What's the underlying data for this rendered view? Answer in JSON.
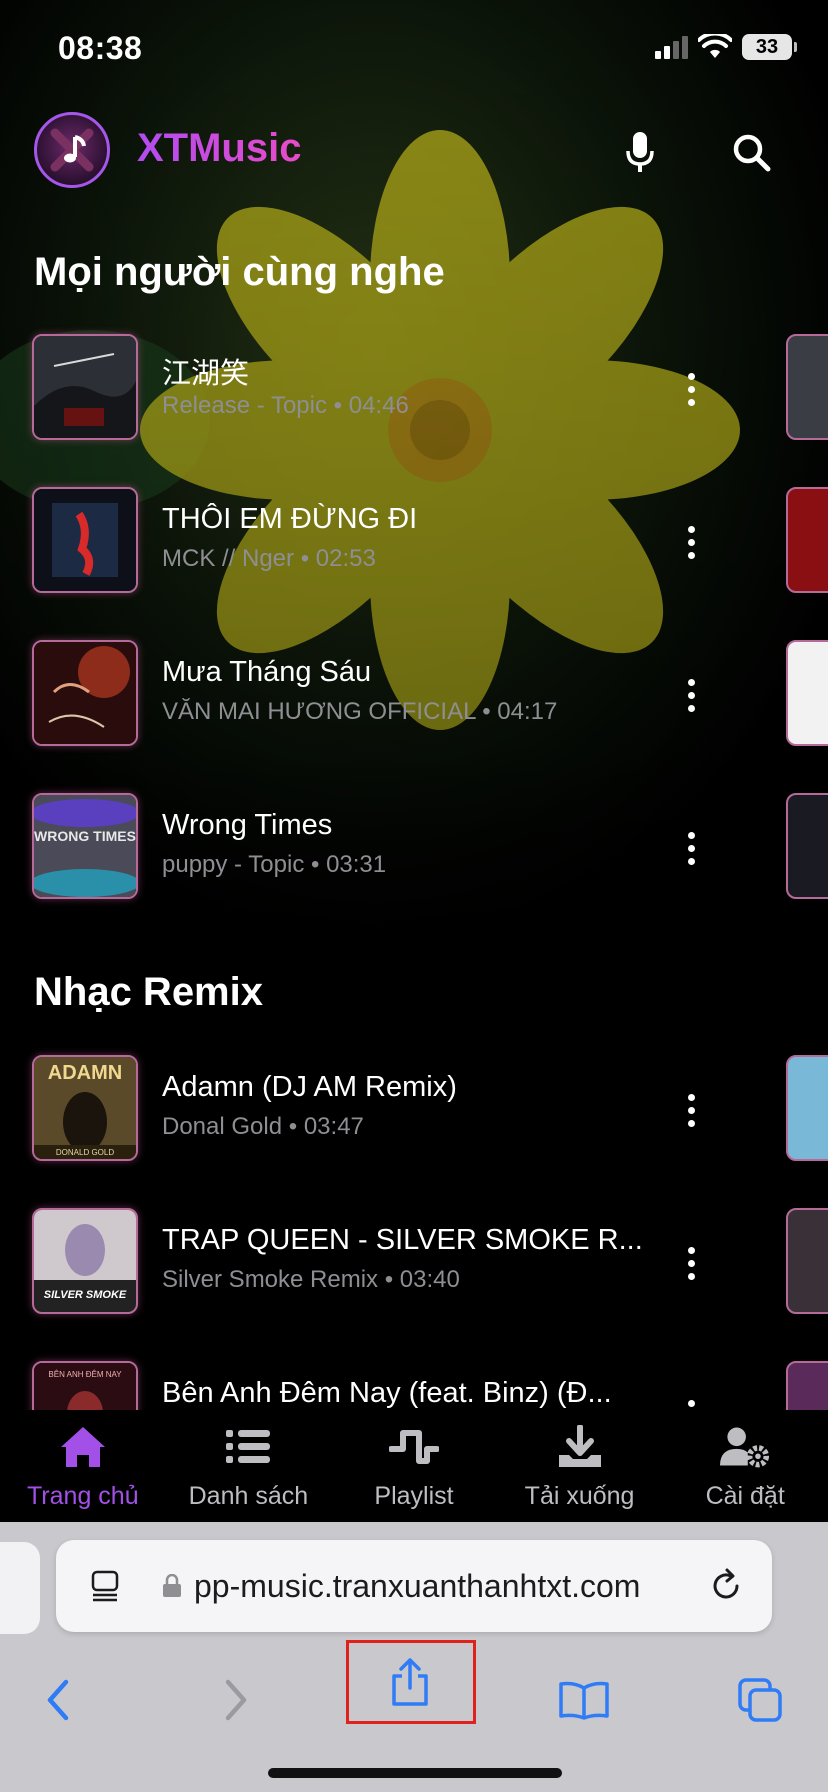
{
  "status_bar": {
    "time": "08:38",
    "battery": "33"
  },
  "header": {
    "app_title": "XTMusic"
  },
  "sections": [
    {
      "title": "Mọi người cùng nghe",
      "songs": [
        {
          "title": "江湖笑",
          "artist": "Release - Topic",
          "duration": "04:46"
        },
        {
          "title": "THÔI EM ĐỪNG ĐI",
          "artist": "MCK // Nger",
          "duration": "02:53"
        },
        {
          "title": "Mưa Tháng Sáu",
          "artist": "VĂN MAI HƯƠNG OFFICIAL",
          "duration": "04:17"
        },
        {
          "title": "Wrong Times",
          "artist": "puppy - Topic",
          "duration": "03:31"
        }
      ]
    },
    {
      "title": "Nhạc Remix",
      "songs": [
        {
          "title": "Adamn (DJ AM Remix)",
          "artist": "Donal Gold",
          "duration": "03:47"
        },
        {
          "title": "TRAP QUEEN - SILVER SMOKE R...",
          "artist": "Silver Smoke Remix",
          "duration": "03:40"
        },
        {
          "title": "Bên Anh Đêm Nay (feat. Binz) (Đ...",
          "artist": "",
          "duration": ""
        }
      ]
    }
  ],
  "thumb_text": {
    "wrong_times": "WRONG TIMES",
    "adamn": "ADAMN",
    "donald_gold": "DONALD GOLD",
    "silver_smoke": "SILVER SMOKE",
    "ben_anh": "BÊN ANH ĐÊM NAY"
  },
  "meta_separator": "•",
  "tabs": [
    {
      "label": "Trang chủ",
      "icon": "home-icon",
      "active": true
    },
    {
      "label": "Danh sách",
      "icon": "list-icon",
      "active": false
    },
    {
      "label": "Playlist",
      "icon": "waveform-icon",
      "active": false
    },
    {
      "label": "Tải xuống",
      "icon": "download-icon",
      "active": false
    },
    {
      "label": "Cài đặt",
      "icon": "user-gear-icon",
      "active": false
    }
  ],
  "browser": {
    "url": "pp-music.tranxuanthanhtxt.com"
  },
  "colors": {
    "accent": "#a350e8",
    "title_gradient_start": "#b14cf0",
    "title_gradient_end": "#e94bc9",
    "highlight": "#e0221c"
  }
}
